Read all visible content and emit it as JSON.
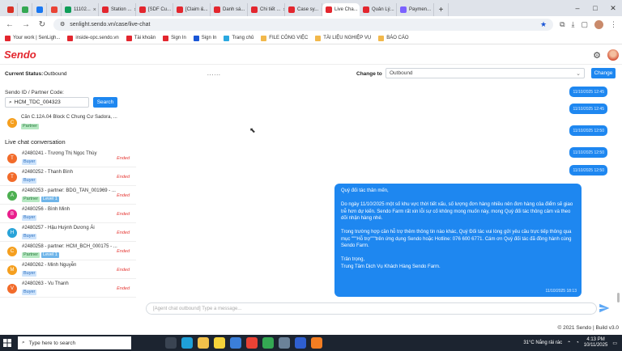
{
  "browser": {
    "tabs": [
      {
        "label": "",
        "icon": "gmail-icon",
        "color": "#d93025",
        "kind": "mini"
      },
      {
        "label": "",
        "icon": "google-drive-icon",
        "color": "#34a853",
        "kind": "mini"
      },
      {
        "label": "",
        "icon": "messenger-icon",
        "color": "#1877f2",
        "kind": "mini"
      },
      {
        "label": "",
        "icon": "google-icon",
        "color": "#ea4335",
        "kind": "mini"
      },
      {
        "label": "11102...",
        "icon": "sheet-icon",
        "color": "#0f9d58",
        "kind": "wide"
      },
      {
        "label": "Station ...",
        "icon": "sendo-icon",
        "color": "#e3262e",
        "kind": "wide"
      },
      {
        "label": "[SDF Cu...",
        "icon": "sendo-icon",
        "color": "#e3262e",
        "kind": "wide"
      },
      {
        "label": "[Claim &...",
        "icon": "sendo-icon",
        "color": "#e3262e",
        "kind": "wide"
      },
      {
        "label": "Danh sá...",
        "icon": "sendo-icon",
        "color": "#e3262e",
        "kind": "wide"
      },
      {
        "label": "Chi tiết ...",
        "icon": "sendo-icon",
        "color": "#e3262e",
        "kind": "wide"
      },
      {
        "label": "Case sy...",
        "icon": "sendo-icon",
        "color": "#e3262e",
        "kind": "wide"
      },
      {
        "label": "Live Cha...",
        "icon": "sendo-icon",
        "color": "#e3262e",
        "kind": "active"
      },
      {
        "label": "Quản Lý...",
        "icon": "sendo-icon",
        "color": "#e3262e",
        "kind": "wide"
      },
      {
        "label": "Paymen...",
        "icon": "payment-icon",
        "color": "#7b61ff",
        "kind": "wide"
      }
    ],
    "url": "senlight.sendo.vn/case/live-chat",
    "bookmarks": [
      {
        "label": "Your work | SenLigh...",
        "color": "#e3262e"
      },
      {
        "label": "inside-opc.sendo.vn",
        "color": "#e3262e"
      },
      {
        "label": "Tài khoản",
        "color": "#e3262e"
      },
      {
        "label": "Sign In",
        "color": "#e3262e"
      },
      {
        "label": "Sign In",
        "color": "#1a56d6"
      },
      {
        "label": "Trang chủ",
        "color": "#2aa8e0"
      },
      {
        "label": "FILE CÔNG VIỆC",
        "color": "#f2b84b"
      },
      {
        "label": "TÀI LIỆU NGHIỆP VỤ",
        "color": "#f2b84b"
      },
      {
        "label": "BÁO CÁO",
        "color": "#f2b84b"
      }
    ]
  },
  "app": {
    "logo": "Sendo",
    "status_label": "Current Status:",
    "status_value": "Outbound",
    "status_dots": "......",
    "change_to_label": "Change to",
    "change_to_value": "Outbound",
    "change_button": "Change"
  },
  "left": {
    "sendo_id_label": "Sendo ID / Partner Code:",
    "search_value": "HCM_TDC_004323",
    "search_button": "Search",
    "partner": {
      "initial": "C",
      "name": "Căn C.12A.04 Block C Chung Cư Sadora, ...",
      "tag": "Partner",
      "color": "#f59f1e"
    },
    "live_chat_title": "Live chat conversation",
    "conversations": [
      {
        "initial": "T",
        "name": "#2480241 - Trương Thị Ngọc Thùy",
        "tags": [
          "Buyer"
        ],
        "level": "",
        "status": "Ended",
        "color": "#f26b2a"
      },
      {
        "initial": "T",
        "name": "#2480252 - Thanh Bình",
        "tags": [
          "Buyer"
        ],
        "level": "",
        "status": "Ended",
        "color": "#f26b2a"
      },
      {
        "initial": "A",
        "name": "#2480253 - partner: BDG_TAN_001969 - ...",
        "tags": [
          "Partner"
        ],
        "level": "Level 1",
        "status": "Ended",
        "color": "#4caf50"
      },
      {
        "initial": "B",
        "name": "#2480256 - Bình Minh",
        "tags": [
          "Buyer"
        ],
        "level": "",
        "status": "Ended",
        "color": "#e91e8c"
      },
      {
        "initial": "H",
        "name": "#2480257 - Hậu Huỳnh Dương Ái",
        "tags": [
          "Buyer"
        ],
        "level": "",
        "status": "Ended",
        "color": "#29a3d8"
      },
      {
        "initial": "C",
        "name": "#2480258 - partner: HCM_BCH_000175 - ...",
        "tags": [
          "Partner"
        ],
        "level": "Level 1",
        "status": "Ended",
        "color": "#f59f1e"
      },
      {
        "initial": "M",
        "name": "#2480262 - Minh Nguyễn",
        "tags": [
          "Buyer"
        ],
        "level": "",
        "status": "Ended",
        "color": "#f59f1e"
      },
      {
        "initial": "V",
        "name": "#2480263 - Vu Thanh",
        "tags": [
          "Buyer"
        ],
        "level": "",
        "status": "Ended",
        "color": "#f26b2a"
      }
    ]
  },
  "chat": {
    "small_messages": [
      {
        "time": "11/10/2025 12:45"
      },
      {
        "time": "11/10/2025 12:45"
      },
      {
        "time": "11/10/2025 12:50"
      },
      {
        "time": "11/10/2025 12:50"
      },
      {
        "time": "11/10/2025 12:50"
      }
    ],
    "big_message": {
      "greeting": "Quý đối tác thân mến,",
      "para1": "Do ngày 11/10/2025 một số khu vực thời tiết xấu, số lượng đơn hàng nhiều nên đơn hàng của điểm sẽ giao trễ hơn dự kiến. Sendo Farm rất xin lỗi sự cố không mong muốn này, mong Quý đối tác thông cảm và theo dõi nhận hàng nhé.",
      "para2": "Trong trường hợp cần hỗ trợ thêm thông tin nào khác, Quý Đối tác vui lòng gửi yêu cầu trực tiếp thông qua mục \"\"\"Hỗ trợ\"\"\"trên ứng dụng Sendo hoặc Hotline: 076 600 6771. Cám ơn Quý đối tác đã đồng hành cùng Sendo Farm.",
      "sign1": "Trân trọng,",
      "sign2": "Trung Tâm Dịch Vụ Khách Hàng Sendo Farm.",
      "time": "11/10/2025 18:13"
    },
    "input_placeholder": "[Agent chat outbound] Type a message..."
  },
  "footer": "© 2021 Sendo | Build v3.0",
  "taskbar": {
    "search_placeholder": "Type here to search",
    "weather": "31°C  Nắng rải rác",
    "time": "4:13 PM",
    "date": "10/11/2025"
  }
}
